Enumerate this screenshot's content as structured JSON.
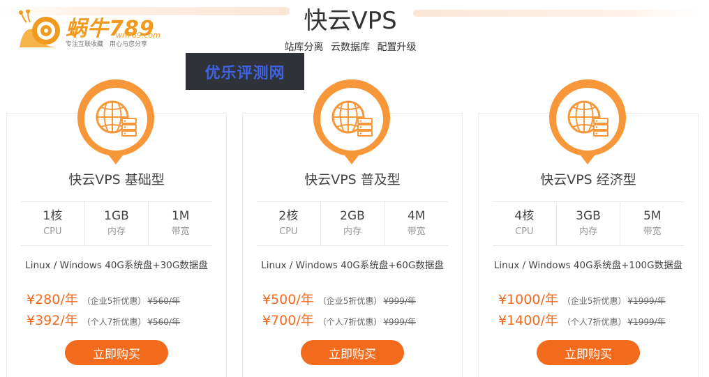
{
  "logo": {
    "brand": "蜗牛789",
    "domain": "wn789.com",
    "slogan": "专注互联收藏　用心与您分享"
  },
  "header": {
    "title": "快云VPS",
    "subtitle": "站库分离 云数据库 配置升级"
  },
  "watermark": {
    "text": "优乐评测网"
  },
  "colors": {
    "accent": "#f26a1b",
    "brand_orange": "#f29a1f",
    "price": "#f26b1d"
  },
  "plans": [
    {
      "name": "快云VPS 基础型",
      "icon": "globe-server-icon",
      "specs": [
        {
          "value": "1核",
          "label": "CPU"
        },
        {
          "value": "1GB",
          "label": "内存"
        },
        {
          "value": "1M",
          "label": "带宽"
        }
      ],
      "desc": "Linux / Windows 40G系统盘+30G数据盘",
      "prices": [
        {
          "price": "¥280/年",
          "discount": "（企业5折优惠）",
          "original": "¥560/年"
        },
        {
          "price": "¥392/年",
          "discount": "（个人7折优惠）",
          "original": "¥560/年"
        }
      ],
      "button": "立即购买"
    },
    {
      "name": "快云VPS 普及型",
      "icon": "globe-server-icon",
      "specs": [
        {
          "value": "2核",
          "label": "CPU"
        },
        {
          "value": "2GB",
          "label": "内存"
        },
        {
          "value": "4M",
          "label": "带宽"
        }
      ],
      "desc": "Linux / Windows 40G系统盘+60G数据盘",
      "prices": [
        {
          "price": "¥500/年",
          "discount": "（企业5折优惠）",
          "original": "¥999/年"
        },
        {
          "price": "¥700/年",
          "discount": "（个人7折优惠）",
          "original": "¥999/年"
        }
      ],
      "button": "立即购买"
    },
    {
      "name": "快云VPS 经济型",
      "icon": "globe-server-icon",
      "specs": [
        {
          "value": "4核",
          "label": "CPU"
        },
        {
          "value": "3GB",
          "label": "内存"
        },
        {
          "value": "5M",
          "label": "带宽"
        }
      ],
      "desc": "Linux / Windows 40G系统盘+100G数据盘",
      "prices": [
        {
          "price": "¥1000/年",
          "discount": "（企业5折优惠）",
          "original": "¥1999/年"
        },
        {
          "price": "¥1400/年",
          "discount": "（个人7折优惠）",
          "original": "¥1999/年"
        }
      ],
      "button": "立即购买"
    }
  ]
}
